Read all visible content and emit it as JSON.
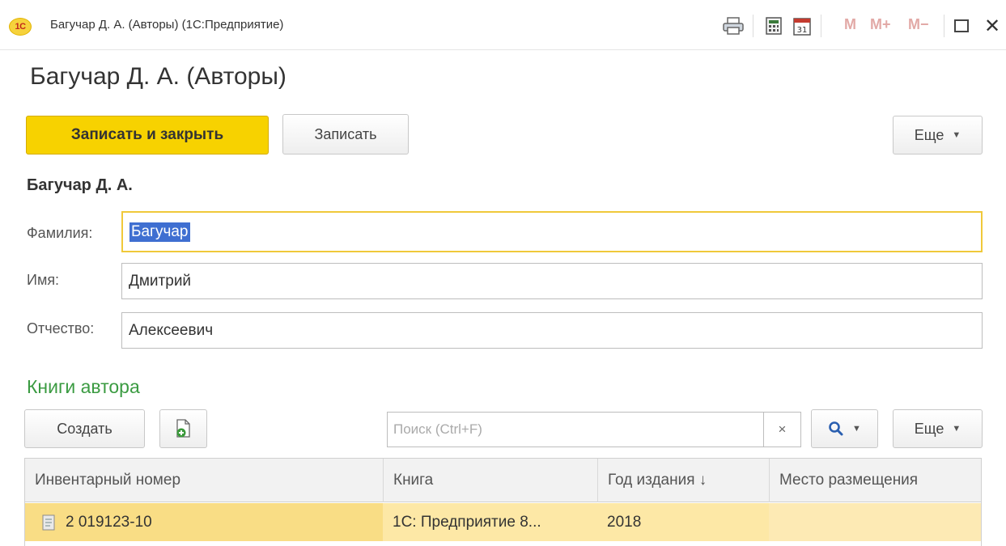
{
  "window": {
    "app_logo": "1С",
    "title": "Багучар Д. А. (Авторы)  (1С:Предприятие)",
    "memory_buttons": {
      "m": "M",
      "m_plus": "M+",
      "m_minus": "M−"
    },
    "close_glyph": "✕"
  },
  "form": {
    "title": "Багучар Д. А. (Авторы)",
    "toolbar": {
      "save_close_label": "Записать и закрыть",
      "save_label": "Записать",
      "more_label": "Еще"
    },
    "subtitle": "Багучар Д. А.",
    "fields": {
      "last_name_label": "Фамилия:",
      "last_name_value": "Багучар",
      "first_name_label": "Имя:",
      "first_name_value": "Дмитрий",
      "patronymic_label": "Отчество:",
      "patronymic_value": "Алексеевич"
    }
  },
  "books": {
    "section_title": "Книги автора",
    "toolbar": {
      "create_label": "Создать",
      "search_placeholder": "Поиск (Ctrl+F)",
      "clear_glyph": "×",
      "more_label": "Еще"
    },
    "columns": [
      "Инвентарный номер",
      "Книга",
      "Год издания ↓",
      "Место размещения"
    ],
    "rows": [
      {
        "inventory": "2 019123-10",
        "book": "1С: Предприятие 8...",
        "year": "2018",
        "location": ""
      }
    ]
  },
  "colors": {
    "primary_button": "#f7d200",
    "section_title": "#3b9b42",
    "selection": "#3f6fd1",
    "active_field_border": "#f0c93a",
    "selected_row": "#fbeca4"
  },
  "icons": [
    "print-icon",
    "calculator-icon",
    "calendar-icon",
    "maximize-icon",
    "close-icon",
    "copy-add-icon",
    "search-icon",
    "chevron-down-icon",
    "document-icon"
  ]
}
